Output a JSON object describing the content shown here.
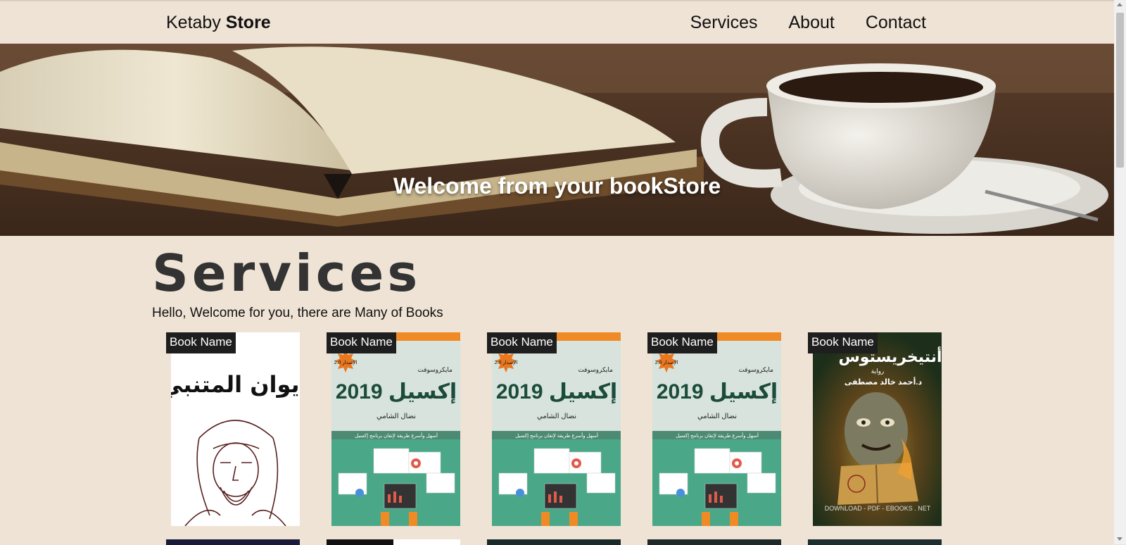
{
  "navbar": {
    "brand_light": "Ketaby",
    "brand_bold": "Store",
    "links": [
      "Services",
      "About",
      "Contact"
    ]
  },
  "hero": {
    "headline": "Welcome from your bookStore"
  },
  "services": {
    "title": "Services",
    "subtitle": "Hello, Welcome for you, there are Many of Books"
  },
  "books": [
    {
      "label": "Book Name",
      "cover": "poet-portrait",
      "cover_title": "ديوان المتنبي"
    },
    {
      "label": "Book Name",
      "cover": "excel-2019",
      "cover_title": "إكسيل 2019",
      "cover_author": "نضال الشامي",
      "cover_brand": "مايكروسوفت",
      "cover_tagline": "أسهل وأسرع طريقة لإتقان برنامج إكسيل",
      "badge": "الإصدار 2.0"
    },
    {
      "label": "Book Name",
      "cover": "excel-2019",
      "cover_title": "إكسيل 2019",
      "cover_author": "نضال الشامي",
      "cover_brand": "مايكروسوفت",
      "cover_tagline": "أسهل وأسرع طريقة لإتقان برنامج إكسيل",
      "badge": "الإصدار 2.0"
    },
    {
      "label": "Book Name",
      "cover": "excel-2019",
      "cover_title": "إكسيل 2019",
      "cover_author": "نضال الشامي",
      "cover_brand": "مايكروسوفت",
      "cover_tagline": "أسهل وأسرع طريقة لإتقان برنامج إكسيل",
      "badge": "الإصدار 2.0"
    },
    {
      "label": "Book Name",
      "cover": "antikhristos",
      "cover_title": "أنتيخريستوس",
      "cover_subtitle": "رواية",
      "cover_author": "د.أحمد خالد مصطفى",
      "cover_footer": "DOWNLOAD - PDF - EBOOKS . NET"
    }
  ],
  "colors": {
    "page_bg": "#efe3d5",
    "excel_orange": "#f08a24",
    "excel_green": "#4aa889",
    "tag_bg": "#1e1e1e"
  }
}
